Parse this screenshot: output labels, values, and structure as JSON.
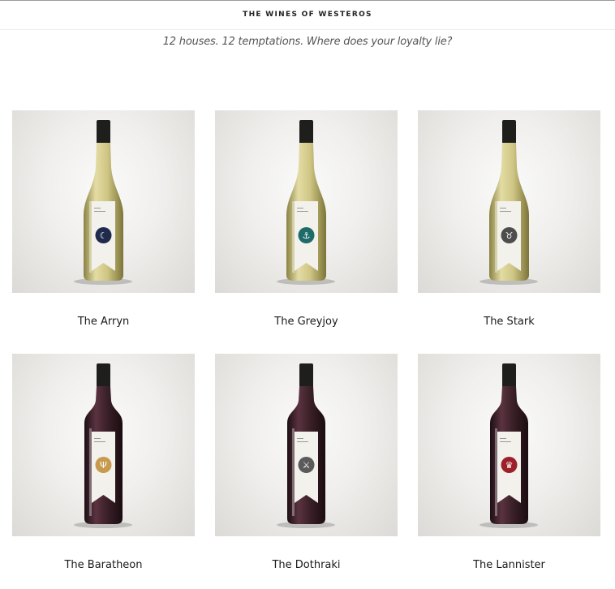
{
  "header": {
    "title": "THE WINES OF WESTEROS",
    "tagline": "12 houses. 12 temptations. Where does your loyalty lie?"
  },
  "wines": [
    {
      "name": "The Arryn",
      "wine_type": "white",
      "sigil": "moon-icon",
      "sigil_color": "#1f2a4d",
      "bottle_color": "#c9c28a"
    },
    {
      "name": "The Greyjoy",
      "wine_type": "white",
      "sigil": "kraken-icon",
      "sigil_color": "#1f6b6a",
      "bottle_color": "#c9c28a"
    },
    {
      "name": "The Stark",
      "wine_type": "white",
      "sigil": "direwolf-icon",
      "sigil_color": "#4d4d4d",
      "bottle_color": "#c9c28a"
    },
    {
      "name": "The Baratheon",
      "wine_type": "red",
      "sigil": "stag-icon",
      "sigil_color": "#c79a4e",
      "bottle_color": "#3a2028"
    },
    {
      "name": "The Dothraki",
      "wine_type": "red",
      "sigil": "arakh-icon",
      "sigil_color": "#5a5a5a",
      "bottle_color": "#3a2028"
    },
    {
      "name": "The Lannister",
      "wine_type": "red",
      "sigil": "lion-icon",
      "sigil_color": "#9c1f2a",
      "bottle_color": "#3a2028"
    }
  ]
}
